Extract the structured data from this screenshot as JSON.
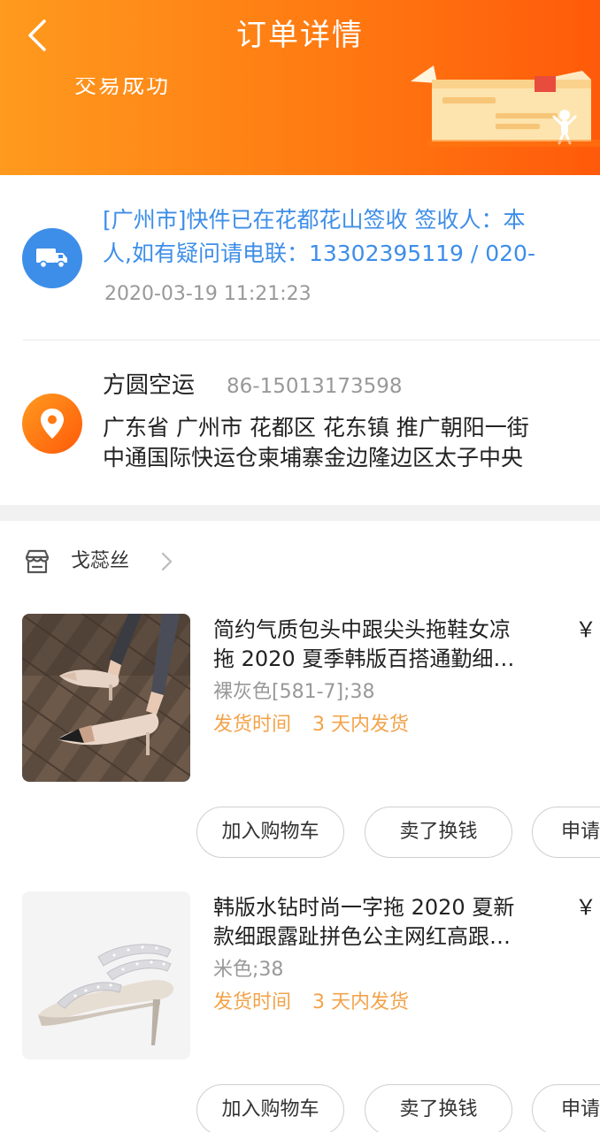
{
  "header": {
    "title": "订单详情",
    "order_status": "交易成功"
  },
  "logistics": {
    "line1": "[广州市]快件已在花都花山签收 签收人：本",
    "line2": "人,如有疑问请电联：13302395119 / 020-",
    "time": "2020-03-19 11:21:23"
  },
  "address": {
    "name": "方圆空运",
    "phone": "86-15013173598",
    "line1": "广东省 广州市 花都区 花东镇 推广朝阳一街",
    "line2": "中通国际快运仓柬埔寨金边隆边区太子中央"
  },
  "shop": {
    "name": "戈蕊丝"
  },
  "products": [
    {
      "title_line1": "简约气质包头中跟尖头拖鞋女凉",
      "title_line2": "拖 2020 夏季韩版百搭通勤细…",
      "price_symbol": "￥",
      "spec": "裸灰色[581-7];38",
      "ship_label": "发货时间",
      "ship_value": "3 天内发货",
      "buttons": {
        "cart": "加入购物车",
        "resell": "卖了换钱",
        "apply": "申请"
      }
    },
    {
      "title_line1": "韩版水钻时尚一字拖 2020 夏新",
      "title_line2": "款细跟露趾拼色公主网红高跟…",
      "price_symbol": "￥",
      "spec": "米色;38",
      "ship_label": "发货时间",
      "ship_value": "3 天内发货",
      "buttons": {
        "cart": "加入购物车",
        "resell": "卖了换钱",
        "apply": "申请"
      }
    }
  ],
  "colors": {
    "header_start": "#ff9a1e",
    "header_end": "#ff5a0a",
    "logistics_blue": "#3d8ee8",
    "shipping_orange": "#f2a34a"
  },
  "icons": [
    "back-arrow-icon",
    "truck-icon",
    "location-pin-icon",
    "shop-icon",
    "chevron-right-icon"
  ]
}
